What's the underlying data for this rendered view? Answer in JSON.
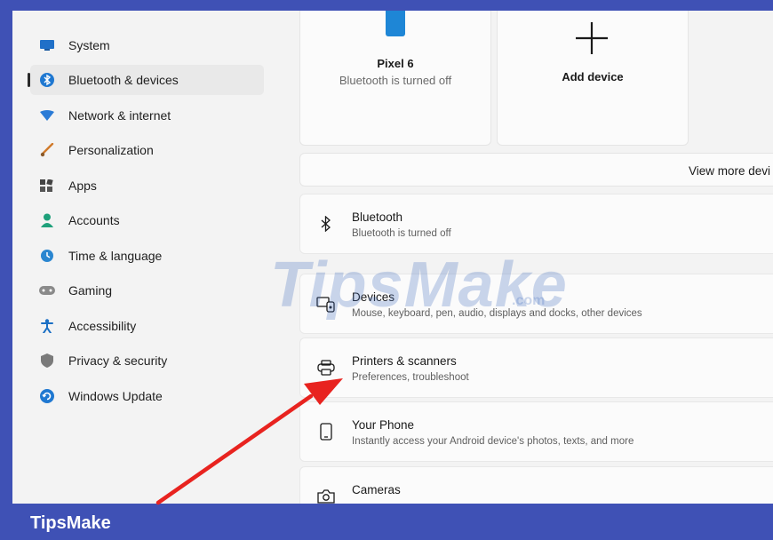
{
  "sidebar": {
    "items": [
      {
        "label": "System",
        "icon": "monitor-icon"
      },
      {
        "label": "Bluetooth & devices",
        "icon": "bluetooth-icon",
        "active": true
      },
      {
        "label": "Network & internet",
        "icon": "wifi-icon"
      },
      {
        "label": "Personalization",
        "icon": "brush-icon"
      },
      {
        "label": "Apps",
        "icon": "apps-icon"
      },
      {
        "label": "Accounts",
        "icon": "person-icon"
      },
      {
        "label": "Time & language",
        "icon": "globe-clock-icon"
      },
      {
        "label": "Gaming",
        "icon": "controller-icon"
      },
      {
        "label": "Accessibility",
        "icon": "accessibility-icon"
      },
      {
        "label": "Privacy & security",
        "icon": "shield-icon"
      },
      {
        "label": "Windows Update",
        "icon": "update-icon"
      }
    ]
  },
  "devices": {
    "pixel": {
      "name": "Pixel 6",
      "status": "Bluetooth is turned off"
    },
    "add": {
      "label": "Add device"
    },
    "view_more": "View more devi"
  },
  "rows": [
    {
      "title": "Bluetooth",
      "subtitle": "Bluetooth is turned off",
      "icon": "bluetooth-icon"
    },
    {
      "title": "Devices",
      "subtitle": "Mouse, keyboard, pen, audio, displays and docks, other devices",
      "icon": "devices-icon"
    },
    {
      "title": "Printers & scanners",
      "subtitle": "Preferences, troubleshoot",
      "icon": "printer-icon"
    },
    {
      "title": "Your Phone",
      "subtitle": "Instantly access your Android device's photos, texts, and more",
      "icon": "phone-icon"
    },
    {
      "title": "Cameras",
      "subtitle": "",
      "icon": "camera-icon"
    }
  ],
  "watermark": {
    "text": "TipsMake",
    "suffix": ".com"
  },
  "footer": {
    "label": "TipsMake"
  },
  "colors": {
    "frame": "#3f51b5",
    "arrow": "#e8231f",
    "accent": "#0067c0"
  }
}
